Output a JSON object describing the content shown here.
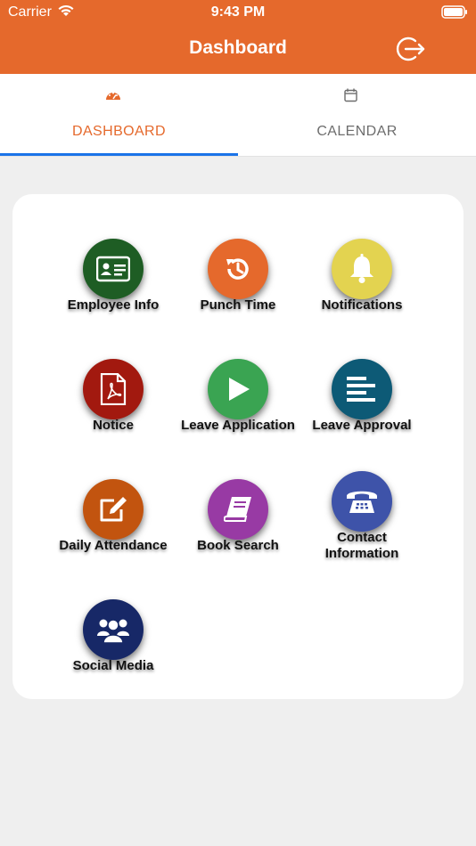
{
  "status_bar": {
    "carrier": "Carrier",
    "time": "9:43 PM"
  },
  "nav": {
    "title": "Dashboard",
    "logout_icon": "logout-icon"
  },
  "tabs": [
    {
      "label": "DASHBOARD",
      "icon": "speedometer-icon",
      "active": true
    },
    {
      "label": "CALENDAR",
      "icon": "calendar-icon",
      "active": false
    }
  ],
  "tiles": [
    {
      "label": "Employee Info",
      "icon": "id-card-icon",
      "color": "#1e5d24"
    },
    {
      "label": "Punch Time",
      "icon": "history-icon",
      "color": "#e5692c"
    },
    {
      "label": "Notifications",
      "icon": "bell-icon",
      "color": "#e3d350"
    },
    {
      "label": "Notice",
      "icon": "pdf-file-icon",
      "color": "#a2190f"
    },
    {
      "label": "Leave Application",
      "icon": "play-icon",
      "color": "#3aa452"
    },
    {
      "label": "Leave Approval",
      "icon": "align-left-icon",
      "color": "#0d5a76"
    },
    {
      "label": "Daily Attendance",
      "icon": "edit-icon",
      "color": "#c2540f"
    },
    {
      "label": "Book Search",
      "icon": "book-icon",
      "color": "#983aa4"
    },
    {
      "label": "Contact Information",
      "icon": "phone-icon",
      "color": "#3e53a9"
    },
    {
      "label": "Social Media",
      "icon": "users-icon",
      "color": "#172867"
    }
  ],
  "colors": {
    "accent": "#e5692c",
    "tab_indicator": "#1a73e8",
    "background": "#efefef"
  }
}
